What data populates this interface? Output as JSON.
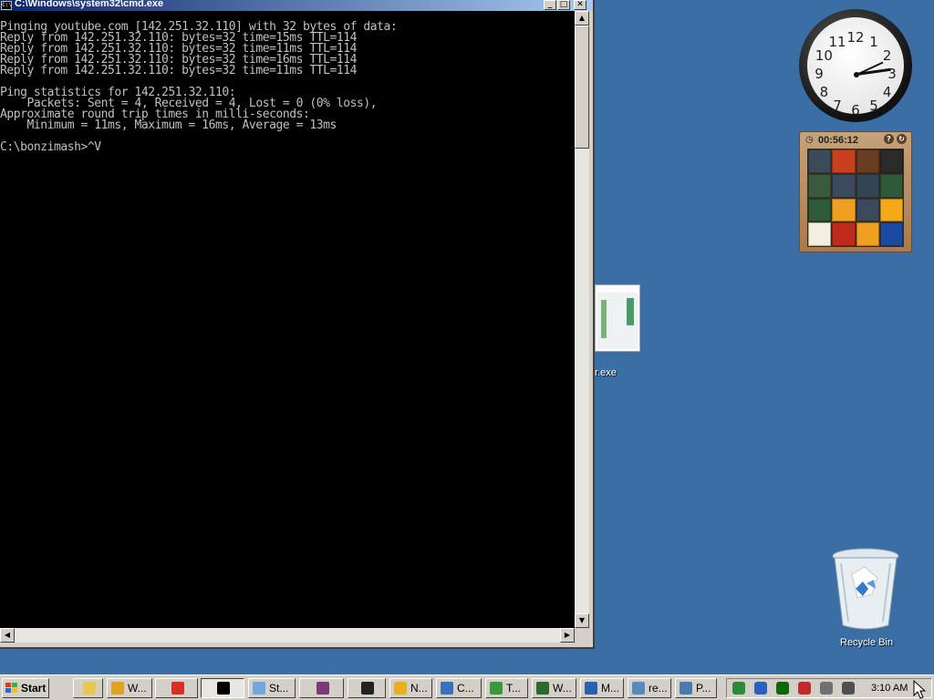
{
  "cmd_window": {
    "title": "C:\\Windows\\system32\\cmd.exe",
    "buttons": {
      "minimize": "_",
      "maximize": "□",
      "close": "✕"
    },
    "lines": [
      "",
      "Pinging youtube.com [142.251.32.110] with 32 bytes of data:",
      "Reply from 142.251.32.110: bytes=32 time=15ms TTL=114",
      "Reply from 142.251.32.110: bytes=32 time=11ms TTL=114",
      "Reply from 142.251.32.110: bytes=32 time=16ms TTL=114",
      "Reply from 142.251.32.110: bytes=32 time=11ms TTL=114",
      "",
      "Ping statistics for 142.251.32.110:",
      "    Packets: Sent = 4, Received = 4, Lost = 0 (0% loss),",
      "Approximate round trip times in milli-seconds:",
      "    Minimum = 11ms, Maximum = 16ms, Average = 13ms",
      "",
      "C:\\bonzimash>^V"
    ],
    "text_color": "#c0c0c0",
    "background": "#000000"
  },
  "gadgets": {
    "clock": {
      "numbers": [
        "12",
        "1",
        "2",
        "3",
        "4",
        "5",
        "6",
        "7",
        "8",
        "9",
        "10",
        "11"
      ],
      "time_shown": "3:10"
    },
    "puzzle": {
      "timer": "00:56:12",
      "tile_colors": [
        "#3c4b5a",
        "#c8401e",
        "#6a3c22",
        "#2a2a2a",
        "#3a5a3e",
        "#3b4a5c",
        "#334455",
        "#2f5a3a",
        "#2e5b3a",
        "#f0a020",
        "#3a4a5a",
        "#f5a818",
        "#f2efe0",
        "#c02a1a",
        "#f0a020",
        "#1a4aa0"
      ]
    }
  },
  "desktop": {
    "icon_exe_label": "r.exe",
    "recycle_bin_label": "Recycle Bin"
  },
  "taskbar": {
    "start_label": "Start",
    "tasks": [
      {
        "label": "",
        "icon": "folder-icon",
        "color": "#e8c850"
      },
      {
        "label": "W...",
        "icon": "media-icon",
        "color": "#e0a020"
      },
      {
        "label": "",
        "icon": "chrome-icon",
        "color": "#d93025"
      },
      {
        "label": "",
        "icon": "cmd-icon",
        "color": "#000000"
      },
      {
        "label": "St...",
        "icon": "app-icon",
        "color": "#6fa8dc"
      },
      {
        "label": "",
        "icon": "winrar-icon",
        "color": "#7a3a7a"
      },
      {
        "label": "",
        "icon": "7zip-icon",
        "color": "#222222"
      },
      {
        "label": "N...",
        "icon": "notes-icon",
        "color": "#e8b020"
      },
      {
        "label": "C...",
        "icon": "shield-icon",
        "color": "#3a70c0"
      },
      {
        "label": "T...",
        "icon": "green-icon",
        "color": "#3a9a3a"
      },
      {
        "label": "W...",
        "icon": "window-icon",
        "color": "#2a6a2a"
      },
      {
        "label": "M...",
        "icon": "shield-icon",
        "color": "#2a60b0"
      },
      {
        "label": "re...",
        "icon": "settings-icon",
        "color": "#5a8ac0"
      },
      {
        "label": "P...",
        "icon": "document-icon",
        "color": "#4a7ab0"
      }
    ],
    "tray_clock": "3:10 AM",
    "tray_icons": [
      "refresh-icon",
      "shield-icon",
      "terminal-icon",
      "network-error-icon",
      "network-icon",
      "volume-icon"
    ]
  }
}
